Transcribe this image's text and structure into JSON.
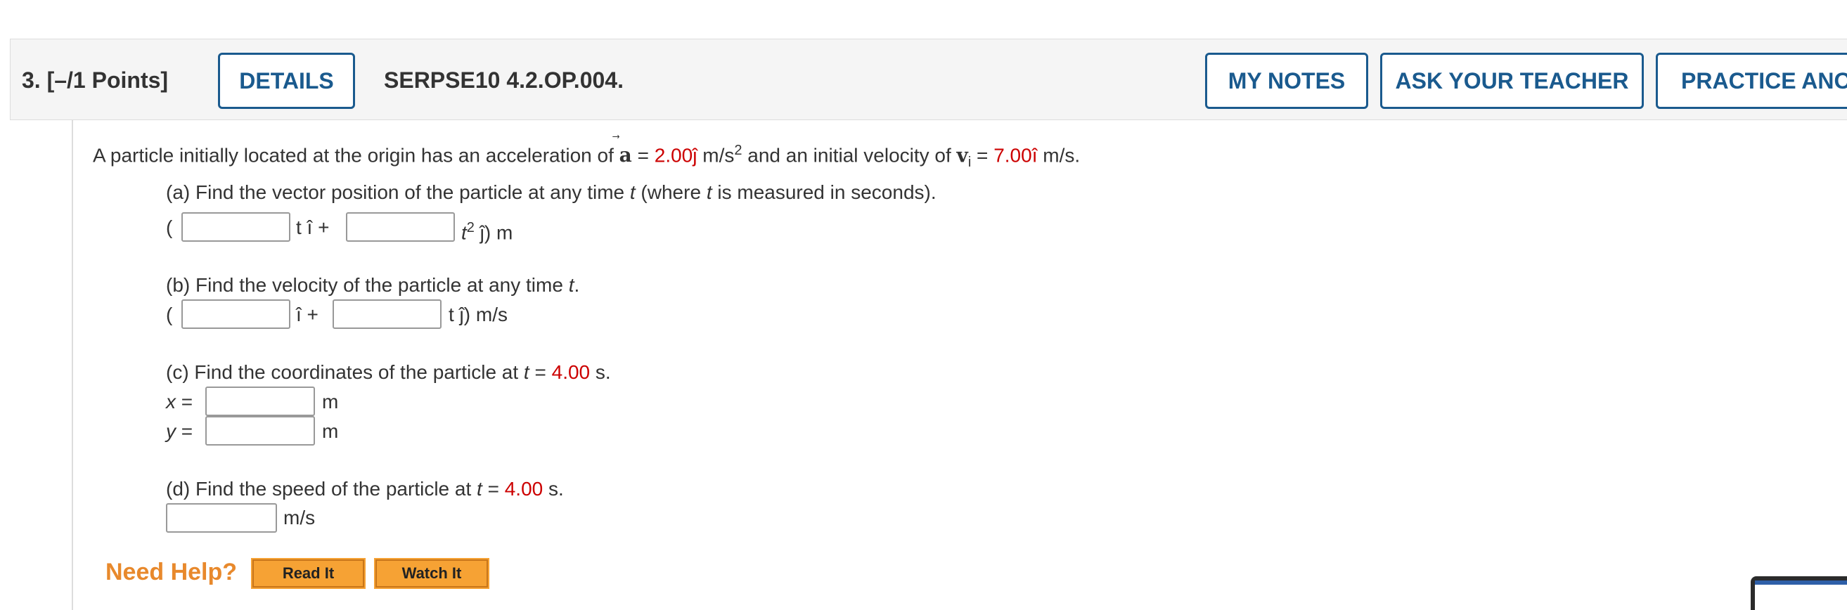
{
  "header": {
    "question_number": "3.",
    "points": "[–/1 Points]",
    "details_label": "DETAILS",
    "problem_code": "SERPSE10 4.2.OP.004.",
    "my_notes_label": "MY NOTES",
    "ask_teacher_label": "ASK YOUR TEACHER",
    "practice_label": "PRACTICE ANOT"
  },
  "problem": {
    "intro_before_a": "A particle initially located at the origin has an acceleration of ",
    "a_symbol": "a",
    "equals": " = ",
    "a_value": "2.00ĵ",
    "a_unit": " m/s",
    "a_exp": "2",
    "intro_middle": " and an initial velocity of ",
    "v_symbol": "v",
    "v_sub": "i",
    "v_value": "7.00î",
    "v_unit": " m/s."
  },
  "part_a": {
    "prompt_before_t": "(a) Find the vector position of the particle at any time ",
    "t": "t",
    "prompt_middle": " (where ",
    "prompt_after": " is measured in seconds).",
    "open_paren": "(",
    "term1": "t î +",
    "term2_t": "t",
    "term2_exp": "2",
    "term2_rest": " ĵ) m",
    "answer1": "",
    "answer2": ""
  },
  "part_b": {
    "prompt": "(b) Find the velocity of the particle at any time ",
    "t": "t",
    "period": ".",
    "open_paren": "(",
    "term1": "î +",
    "term2": "t ĵ) m/s",
    "answer1": "",
    "answer2": ""
  },
  "part_c": {
    "prompt": "(c) Find the coordinates of the particle at ",
    "t": "t",
    "equals": " = ",
    "time_value": "4.00",
    "unit": " s.",
    "x_label": "x",
    "y_label": "y",
    "eq": " =",
    "x_unit": "m",
    "y_unit": "m",
    "x_answer": "",
    "y_answer": ""
  },
  "part_d": {
    "prompt": "(d) Find the speed of the particle at ",
    "t": "t",
    "equals": " = ",
    "time_value": "4.00",
    "unit": " s.",
    "answer_unit": "m/s",
    "answer": ""
  },
  "help": {
    "label": "Need Help?",
    "read_label": "Read It",
    "watch_label": "Watch It"
  },
  "colors": {
    "link_blue": "#1a5a8e",
    "value_red": "#cc0000",
    "help_orange": "#e8892c",
    "button_orange": "#f6a234"
  }
}
